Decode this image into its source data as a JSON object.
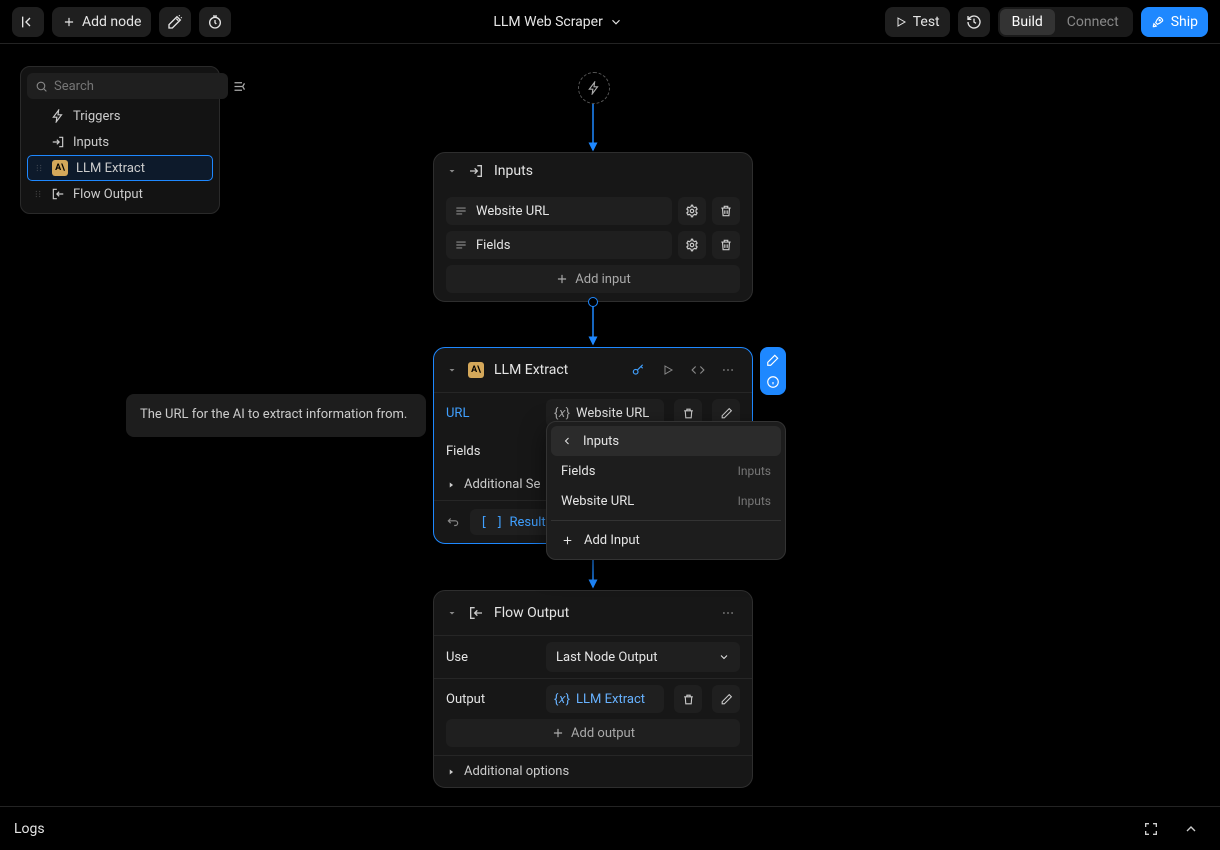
{
  "header": {
    "add_node": "Add node",
    "title": "LLM Web Scraper",
    "test": "Test",
    "build": "Build",
    "connect": "Connect",
    "ship": "Ship"
  },
  "sidebar": {
    "search_placeholder": "Search",
    "items": [
      {
        "label": "Triggers"
      },
      {
        "label": "Inputs"
      },
      {
        "label": "LLM Extract"
      },
      {
        "label": "Flow Output"
      }
    ]
  },
  "inputs_node": {
    "title": "Inputs",
    "rows": [
      {
        "label": "Website URL"
      },
      {
        "label": "Fields"
      }
    ],
    "add": "Add input"
  },
  "llm_node": {
    "title": "LLM Extract",
    "url_label": "URL",
    "url_value": "Website URL",
    "fields_label": "Fields",
    "additional": "Additional Se",
    "results": "Results"
  },
  "tooltip": "The URL for the AI to extract information from.",
  "dropdown": {
    "header": "Inputs",
    "items": [
      {
        "label": "Fields",
        "group": "Inputs"
      },
      {
        "label": "Website URL",
        "group": "Inputs"
      }
    ],
    "add": "Add Input"
  },
  "output_node": {
    "title": "Flow Output",
    "use_label": "Use",
    "use_value": "Last Node Output",
    "output_label": "Output",
    "output_value": "LLM Extract",
    "add": "Add output",
    "additional": "Additional options"
  },
  "logs": {
    "title": "Logs"
  }
}
